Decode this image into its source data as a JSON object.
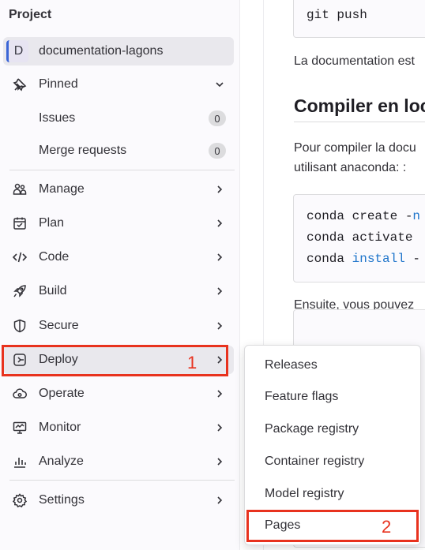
{
  "sidebar": {
    "title": "Project",
    "project": {
      "avatar_letter": "D",
      "name": "documentation-lagons"
    },
    "pinned": {
      "label": "Pinned",
      "items": [
        {
          "label": "Issues",
          "count": "0"
        },
        {
          "label": "Merge requests",
          "count": "0"
        }
      ]
    },
    "nav": [
      {
        "label": "Manage",
        "icon": "users-icon"
      },
      {
        "label": "Plan",
        "icon": "calendar-icon"
      },
      {
        "label": "Code",
        "icon": "code-icon"
      },
      {
        "label": "Build",
        "icon": "rocket-icon"
      },
      {
        "label": "Secure",
        "icon": "shield-icon"
      },
      {
        "label": "Deploy",
        "icon": "deploy-icon"
      },
      {
        "label": "Operate",
        "icon": "cloud-gear-icon"
      },
      {
        "label": "Monitor",
        "icon": "monitor-icon"
      },
      {
        "label": "Analyze",
        "icon": "chart-icon"
      },
      {
        "label": "Settings",
        "icon": "gear-icon"
      }
    ]
  },
  "annotations": {
    "step1": "1",
    "step2": "2",
    "highlight_color": "#e8321e"
  },
  "main": {
    "code_top": "git push",
    "para1": "La documentation est",
    "heading": "Compiler en loca",
    "para2_line1": "Pour compiler la docu",
    "para2_line2": "utilisant anaconda: :",
    "code_block": {
      "line1_cmd": "conda create -",
      "line1_tail": "n",
      "line2": "conda activate",
      "line3_cmd": "conda ",
      "line3_kw": "install",
      "line3_tail": " -"
    },
    "para3": "Ensuite, vous pouvez"
  },
  "deploy_menu": {
    "items": [
      "Releases",
      "Feature flags",
      "Package registry",
      "Container registry",
      "Model registry",
      "Pages"
    ]
  }
}
